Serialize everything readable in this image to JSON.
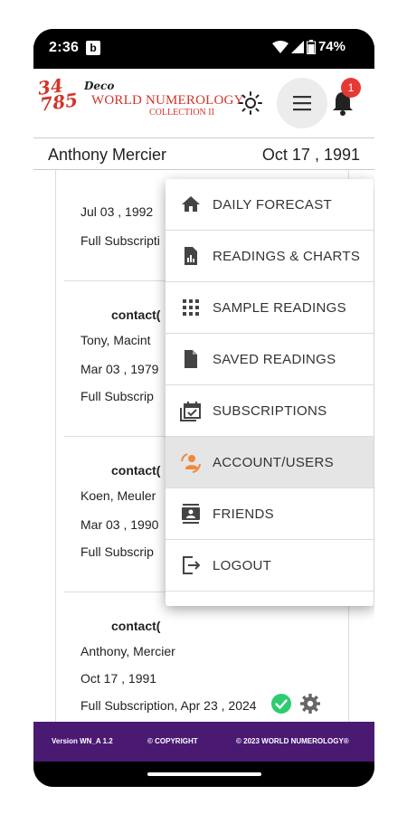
{
  "status_bar": {
    "time": "2:36",
    "notif_icon": "b",
    "battery": "74%"
  },
  "app": {
    "logo_numbers": "34\n785",
    "logo_deco": "Deco",
    "logo_title": "WORLD NUMEROLOGY",
    "logo_sub": "COLLECTION II",
    "notification_count": "1"
  },
  "user": {
    "name": "Anthony Mercier",
    "dob": "Oct 17 , 1991"
  },
  "cards": [
    {
      "email": "",
      "name": "",
      "date": "Jul 03 , 1992",
      "subscription": "Full Subscripti"
    },
    {
      "email": "contact(",
      "name": "Tony, Macint",
      "date": "Mar 03 , 1979",
      "subscription": "Full Subscrip"
    },
    {
      "email": "contact(",
      "name": "Koen, Meuler",
      "date": "Mar 03 , 1990",
      "subscription": "Full Subscrip"
    },
    {
      "email": "contact(",
      "name": "Anthony, Mercier",
      "date": "Oct 17 , 1991",
      "subscription": "Full Subscription, Apr 23 , 2024"
    }
  ],
  "menu": [
    {
      "label": "DAILY FORECAST",
      "icon": "home-icon"
    },
    {
      "label": "READINGS & CHARTS",
      "icon": "chart-document-icon"
    },
    {
      "label": "SAMPLE READINGS",
      "icon": "grid-icon"
    },
    {
      "label": "SAVED READINGS",
      "icon": "document-icon"
    },
    {
      "label": "SUBSCRIPTIONS",
      "icon": "calendar-check-icon"
    },
    {
      "label": "ACCOUNT/USERS",
      "icon": "account-sync-icon"
    },
    {
      "label": "FRIENDS",
      "icon": "contacts-icon"
    },
    {
      "label": "LOGOUT",
      "icon": "logout-icon"
    }
  ],
  "footer": {
    "version": "Version WN_A 1.2",
    "copyright": "© COPYRIGHT",
    "company": "© 2023 WORLD NUMEROLOGY®"
  },
  "colors": {
    "brand_red": "#d1352a",
    "footer_purple": "#4a1a73",
    "badge_red": "#e53935",
    "check_green": "#2ecc71"
  }
}
